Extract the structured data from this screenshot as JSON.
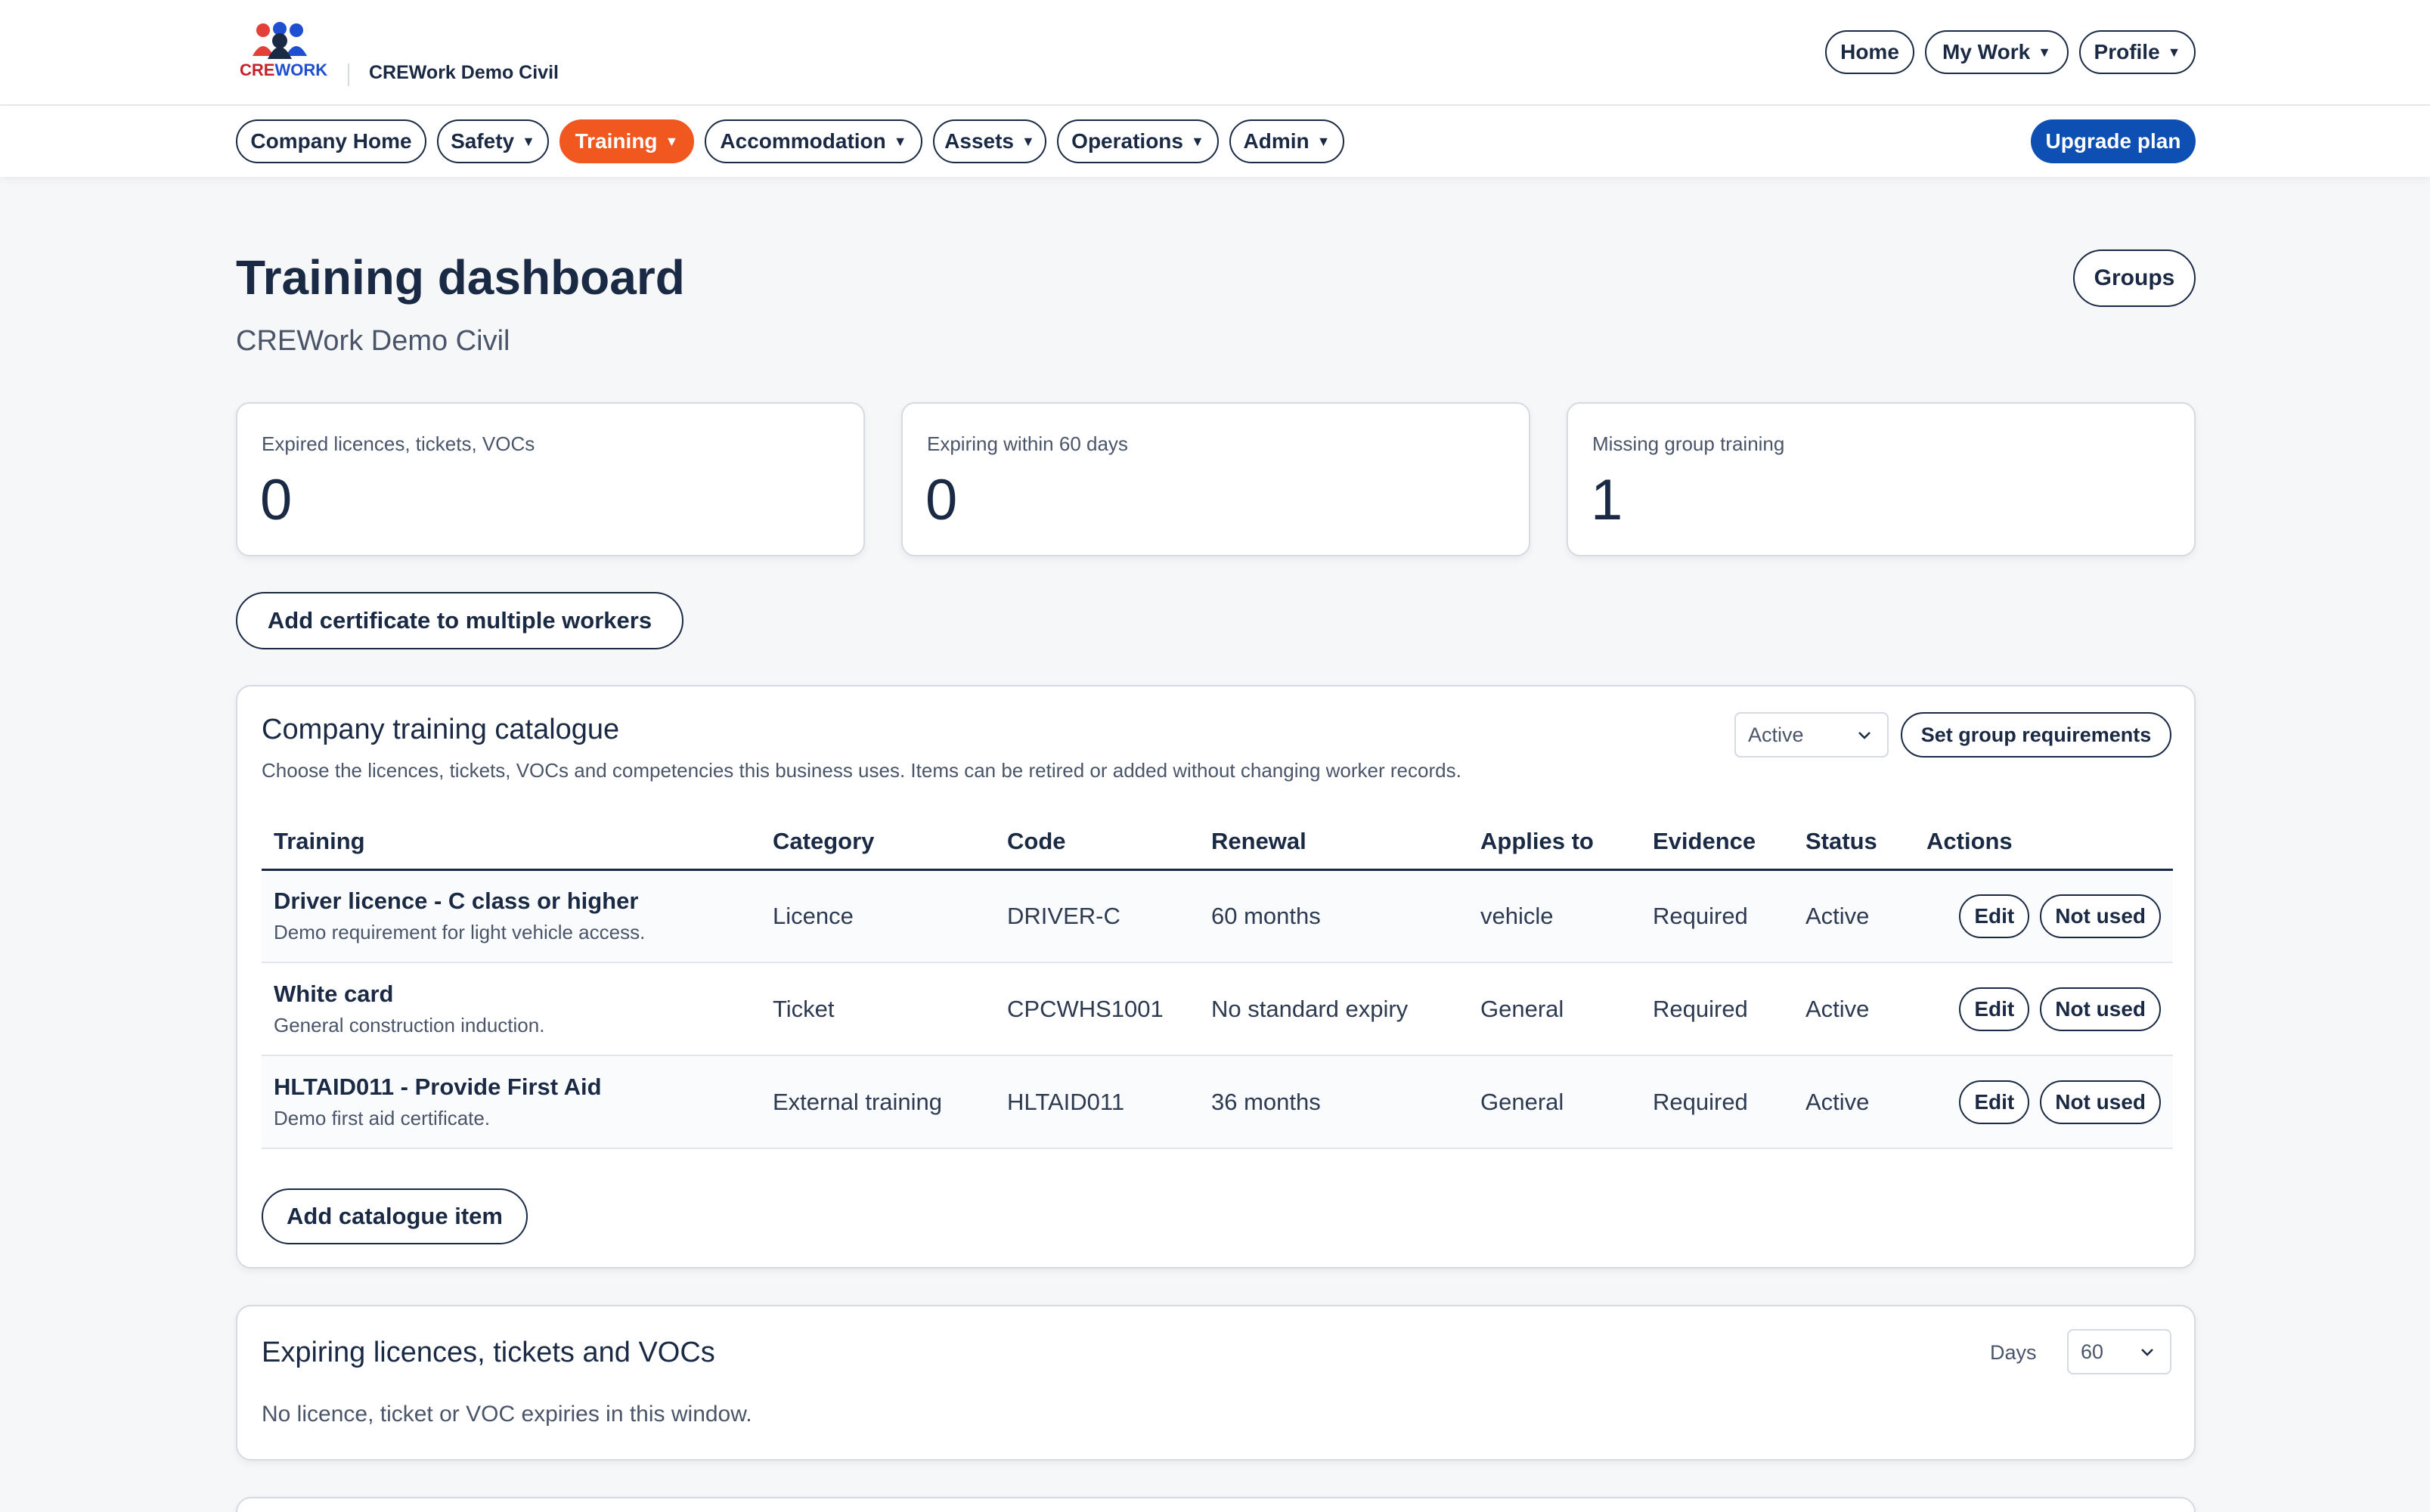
{
  "header": {
    "logo_text_a": "CRE",
    "logo_text_b": "WORK",
    "company": "CREWork Demo Civil",
    "home": "Home",
    "my_work": "My Work",
    "profile": "Profile"
  },
  "nav": {
    "items": [
      "Company Home",
      "Safety",
      "Training",
      "Accommodation",
      "Assets",
      "Operations",
      "Admin"
    ],
    "active": "Training",
    "upgrade": "Upgrade plan"
  },
  "page": {
    "title": "Training dashboard",
    "subtitle": "CREWork Demo Civil",
    "groups_button": "Groups"
  },
  "stats": [
    {
      "label": "Expired licences, tickets, VOCs",
      "value": "0"
    },
    {
      "label": "Expiring within 60 days",
      "value": "0"
    },
    {
      "label": "Missing group training",
      "value": "1"
    }
  ],
  "multi_button": "Add certificate to multiple workers",
  "catalogue": {
    "title": "Company training catalogue",
    "description": "Choose the licences, tickets, VOCs and competencies this business uses. Items can be retired or added without changing worker records.",
    "filter_value": "Active",
    "set_group_button": "Set group requirements",
    "columns": [
      "Training",
      "Category",
      "Code",
      "Renewal",
      "Applies to",
      "Evidence",
      "Status",
      "Actions"
    ],
    "rows": [
      {
        "name": "Driver licence - C class or higher",
        "desc": "Demo requirement for light vehicle access.",
        "category": "Licence",
        "code": "DRIVER-C",
        "renewal": "60 months",
        "applies": "vehicle",
        "evidence": "Required",
        "status": "Active"
      },
      {
        "name": "White card",
        "desc": "General construction induction.",
        "category": "Ticket",
        "code": "CPCWHS1001",
        "renewal": "No standard expiry",
        "applies": "General",
        "evidence": "Required",
        "status": "Active"
      },
      {
        "name": "HLTAID011 - Provide First Aid",
        "desc": "Demo first aid certificate.",
        "category": "External training",
        "code": "HLTAID011",
        "renewal": "36 months",
        "applies": "General",
        "evidence": "Required",
        "status": "Active"
      }
    ],
    "edit_label": "Edit",
    "not_used_label": "Not used",
    "add_item": "Add catalogue item"
  },
  "expiring": {
    "title": "Expiring licences, tickets and VOCs",
    "days_label": "Days",
    "days_value": "60",
    "empty": "No licence, ticket or VOC expiries in this window."
  },
  "colors": {
    "accent": "#f0581f",
    "primary": "#0d4fb3",
    "ink": "#1b2a44"
  }
}
